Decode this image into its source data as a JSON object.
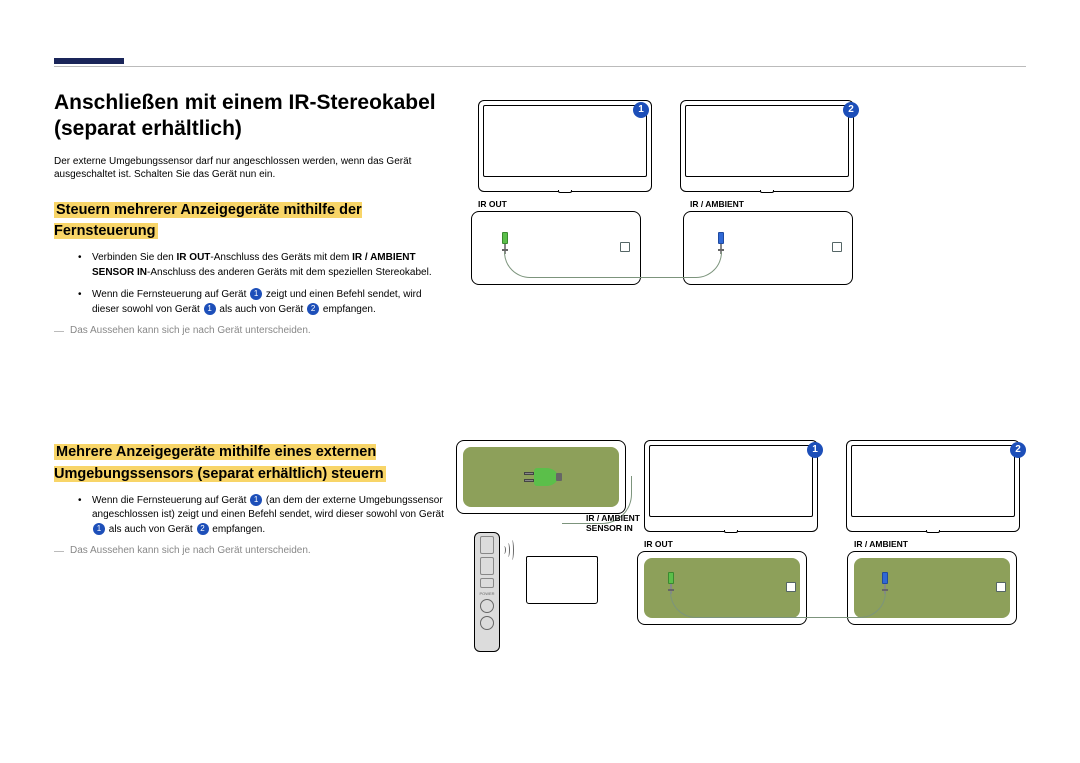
{
  "header": {},
  "main": {
    "title": "Anschließen mit einem IR-Stereokabel (separat erhältlich)",
    "intro": "Der externe Umgebungssensor darf nur angeschlossen werden, wenn das Gerät ausgeschaltet ist. Schalten Sie das Gerät nun ein."
  },
  "section1": {
    "heading": "Steuern mehrerer Anzeigegeräte mithilfe der Fernsteuerung",
    "bullet1_pre": "Verbinden Sie den ",
    "bullet1_b1": "IR OUT",
    "bullet1_mid": "-Anschluss des Geräts mit dem ",
    "bullet1_b2": "IR / AMBIENT SENSOR IN",
    "bullet1_post": "-Anschluss des anderen Geräts mit dem speziellen Stereokabel.",
    "bullet2_pre": "Wenn die Fernsteuerung auf Gerät ",
    "bullet2_mid": " zeigt und einen Befehl sendet, wird dieser sowohl von Gerät ",
    "bullet2_mid2": " als auch von Gerät ",
    "bullet2_post": " empfangen.",
    "note": "Das Aussehen kann sich je nach Gerät unterscheiden."
  },
  "section2": {
    "heading": "Mehrere Anzeigegeräte mithilfe eines externen Umgebungssensors (separat erhältlich) steuern",
    "bullet1_pre": "Wenn die Fernsteuerung auf Gerät ",
    "bullet1_mid": " (an dem der externe Umgebungssensor angeschlossen ist) zeigt und einen Befehl sendet, wird dieser sowohl von Gerät ",
    "bullet1_mid2": " als auch von Gerät ",
    "bullet1_post": " empfangen.",
    "note": "Das Aussehen kann sich je nach Gerät unterscheiden."
  },
  "labels": {
    "ir_out": "IR OUT",
    "ir_ambient": "IR / AMBIENT",
    "sensor_in": "SENSOR IN",
    "num1": "1",
    "num2": "2",
    "power": "POWER"
  }
}
